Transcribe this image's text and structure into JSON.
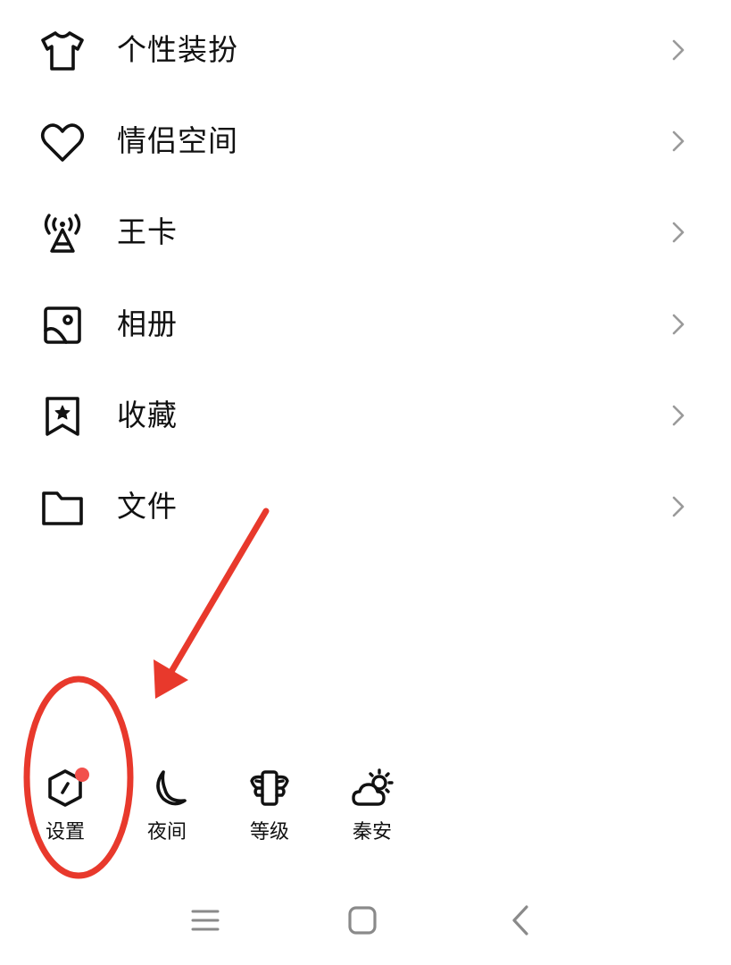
{
  "menu": {
    "items": [
      {
        "label": "个性装扮",
        "icon": "tshirt-icon"
      },
      {
        "label": "情侣空间",
        "icon": "heart-icon"
      },
      {
        "label": "王卡",
        "icon": "signal-tower-icon"
      },
      {
        "label": "相册",
        "icon": "photo-album-icon"
      },
      {
        "label": "收藏",
        "icon": "bookmark-star-icon"
      },
      {
        "label": "文件",
        "icon": "folder-icon"
      }
    ]
  },
  "bottom_bar": {
    "items": [
      {
        "label": "设置",
        "icon": "settings-hexagon-icon",
        "has_badge": true
      },
      {
        "label": "夜间",
        "icon": "moon-icon"
      },
      {
        "label": "等级",
        "icon": "level-phone-wings-icon"
      },
      {
        "label": "秦安",
        "icon": "weather-cloud-sun-icon"
      }
    ]
  },
  "navigation_bar": {
    "buttons": [
      "menu-icon",
      "home-icon",
      "back-icon"
    ]
  },
  "colors": {
    "text": "#111111",
    "chevron": "#9a9a9a",
    "badge": "#f2504b",
    "annotation": "#e8392c"
  }
}
